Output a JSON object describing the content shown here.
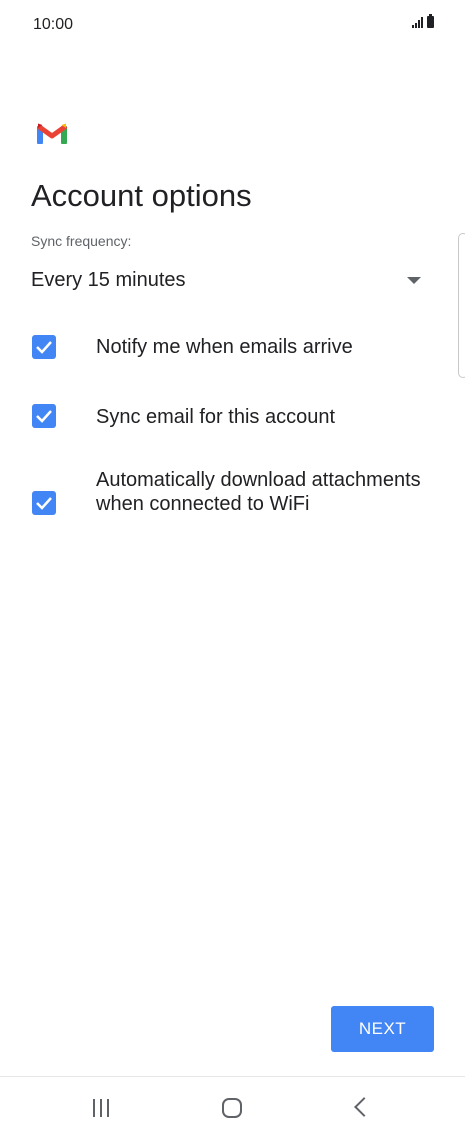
{
  "status_bar": {
    "time": "10:00"
  },
  "header": {
    "logo_icon": "gmail-logo-icon",
    "title": "Account options"
  },
  "sync": {
    "label": "Sync frequency:",
    "selected": "Every 15 minutes"
  },
  "options": [
    {
      "label": "Notify me when emails arrive",
      "checked": true
    },
    {
      "label": "Sync email for this account",
      "checked": true
    },
    {
      "label": "Automatically download attachments when connected to WiFi",
      "checked": true
    }
  ],
  "actions": {
    "next_label": "NEXT"
  },
  "colors": {
    "accent": "#4285f4",
    "text": "#202124",
    "secondary_text": "#5f6368"
  },
  "nav_icons": [
    "recent-apps-icon",
    "home-icon",
    "back-icon"
  ]
}
